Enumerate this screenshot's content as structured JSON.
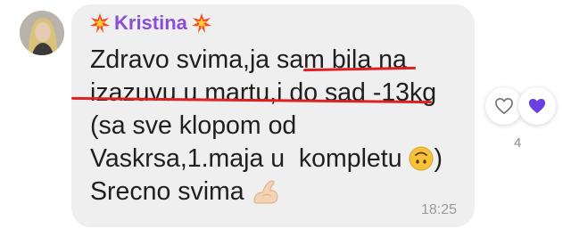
{
  "message": {
    "sender_name": "Kristina",
    "lines": [
      "Zdravo svima,ja sam ",
      "bila na",
      "izazuvu u martu,i do sad -13kg",
      "(sa sve klopom od",
      "Vaskrsa,1.maja u  kompletu ",
      ")",
      "Srecno svima "
    ],
    "time": "18:25"
  },
  "reactions": {
    "count": "4"
  },
  "colors": {
    "bubble": "#efefef",
    "sender": "#8a4fd8",
    "underline": "#e02020",
    "heart_filled": "#6b3fe0"
  },
  "icons": {
    "avatar": "user-avatar",
    "sender_decoration": "collision-emoji-icon",
    "smile": "upside-down-face-emoji-icon",
    "arm": "flexed-biceps-emoji-icon",
    "reaction_outline": "heart-outline-icon",
    "reaction_filled": "heart-filled-icon"
  }
}
